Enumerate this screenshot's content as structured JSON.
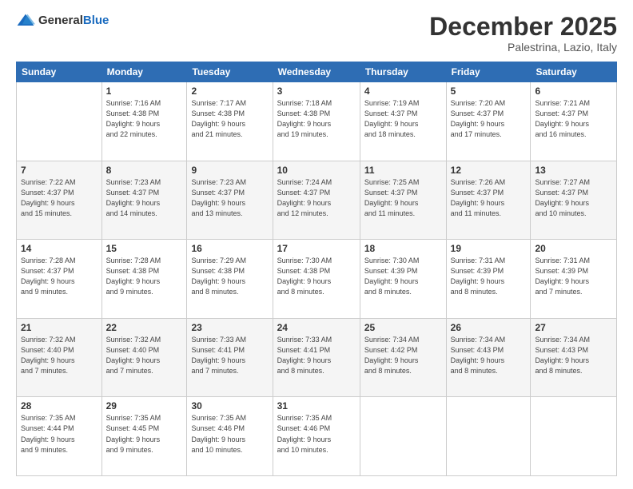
{
  "header": {
    "logo": {
      "general": "General",
      "blue": "Blue"
    },
    "title": "December 2025",
    "subtitle": "Palestrina, Lazio, Italy"
  },
  "calendar": {
    "days_of_week": [
      "Sunday",
      "Monday",
      "Tuesday",
      "Wednesday",
      "Thursday",
      "Friday",
      "Saturday"
    ],
    "weeks": [
      [
        {
          "day": "",
          "info": ""
        },
        {
          "day": "1",
          "info": "Sunrise: 7:16 AM\nSunset: 4:38 PM\nDaylight: 9 hours\nand 22 minutes."
        },
        {
          "day": "2",
          "info": "Sunrise: 7:17 AM\nSunset: 4:38 PM\nDaylight: 9 hours\nand 21 minutes."
        },
        {
          "day": "3",
          "info": "Sunrise: 7:18 AM\nSunset: 4:38 PM\nDaylight: 9 hours\nand 19 minutes."
        },
        {
          "day": "4",
          "info": "Sunrise: 7:19 AM\nSunset: 4:37 PM\nDaylight: 9 hours\nand 18 minutes."
        },
        {
          "day": "5",
          "info": "Sunrise: 7:20 AM\nSunset: 4:37 PM\nDaylight: 9 hours\nand 17 minutes."
        },
        {
          "day": "6",
          "info": "Sunrise: 7:21 AM\nSunset: 4:37 PM\nDaylight: 9 hours\nand 16 minutes."
        }
      ],
      [
        {
          "day": "7",
          "info": "Sunrise: 7:22 AM\nSunset: 4:37 PM\nDaylight: 9 hours\nand 15 minutes."
        },
        {
          "day": "8",
          "info": "Sunrise: 7:23 AM\nSunset: 4:37 PM\nDaylight: 9 hours\nand 14 minutes."
        },
        {
          "day": "9",
          "info": "Sunrise: 7:23 AM\nSunset: 4:37 PM\nDaylight: 9 hours\nand 13 minutes."
        },
        {
          "day": "10",
          "info": "Sunrise: 7:24 AM\nSunset: 4:37 PM\nDaylight: 9 hours\nand 12 minutes."
        },
        {
          "day": "11",
          "info": "Sunrise: 7:25 AM\nSunset: 4:37 PM\nDaylight: 9 hours\nand 11 minutes."
        },
        {
          "day": "12",
          "info": "Sunrise: 7:26 AM\nSunset: 4:37 PM\nDaylight: 9 hours\nand 11 minutes."
        },
        {
          "day": "13",
          "info": "Sunrise: 7:27 AM\nSunset: 4:37 PM\nDaylight: 9 hours\nand 10 minutes."
        }
      ],
      [
        {
          "day": "14",
          "info": "Sunrise: 7:28 AM\nSunset: 4:37 PM\nDaylight: 9 hours\nand 9 minutes."
        },
        {
          "day": "15",
          "info": "Sunrise: 7:28 AM\nSunset: 4:38 PM\nDaylight: 9 hours\nand 9 minutes."
        },
        {
          "day": "16",
          "info": "Sunrise: 7:29 AM\nSunset: 4:38 PM\nDaylight: 9 hours\nand 8 minutes."
        },
        {
          "day": "17",
          "info": "Sunrise: 7:30 AM\nSunset: 4:38 PM\nDaylight: 9 hours\nand 8 minutes."
        },
        {
          "day": "18",
          "info": "Sunrise: 7:30 AM\nSunset: 4:39 PM\nDaylight: 9 hours\nand 8 minutes."
        },
        {
          "day": "19",
          "info": "Sunrise: 7:31 AM\nSunset: 4:39 PM\nDaylight: 9 hours\nand 8 minutes."
        },
        {
          "day": "20",
          "info": "Sunrise: 7:31 AM\nSunset: 4:39 PM\nDaylight: 9 hours\nand 7 minutes."
        }
      ],
      [
        {
          "day": "21",
          "info": "Sunrise: 7:32 AM\nSunset: 4:40 PM\nDaylight: 9 hours\nand 7 minutes."
        },
        {
          "day": "22",
          "info": "Sunrise: 7:32 AM\nSunset: 4:40 PM\nDaylight: 9 hours\nand 7 minutes."
        },
        {
          "day": "23",
          "info": "Sunrise: 7:33 AM\nSunset: 4:41 PM\nDaylight: 9 hours\nand 7 minutes."
        },
        {
          "day": "24",
          "info": "Sunrise: 7:33 AM\nSunset: 4:41 PM\nDaylight: 9 hours\nand 8 minutes."
        },
        {
          "day": "25",
          "info": "Sunrise: 7:34 AM\nSunset: 4:42 PM\nDaylight: 9 hours\nand 8 minutes."
        },
        {
          "day": "26",
          "info": "Sunrise: 7:34 AM\nSunset: 4:43 PM\nDaylight: 9 hours\nand 8 minutes."
        },
        {
          "day": "27",
          "info": "Sunrise: 7:34 AM\nSunset: 4:43 PM\nDaylight: 9 hours\nand 8 minutes."
        }
      ],
      [
        {
          "day": "28",
          "info": "Sunrise: 7:35 AM\nSunset: 4:44 PM\nDaylight: 9 hours\nand 9 minutes."
        },
        {
          "day": "29",
          "info": "Sunrise: 7:35 AM\nSunset: 4:45 PM\nDaylight: 9 hours\nand 9 minutes."
        },
        {
          "day": "30",
          "info": "Sunrise: 7:35 AM\nSunset: 4:46 PM\nDaylight: 9 hours\nand 10 minutes."
        },
        {
          "day": "31",
          "info": "Sunrise: 7:35 AM\nSunset: 4:46 PM\nDaylight: 9 hours\nand 10 minutes."
        },
        {
          "day": "",
          "info": ""
        },
        {
          "day": "",
          "info": ""
        },
        {
          "day": "",
          "info": ""
        }
      ]
    ]
  }
}
